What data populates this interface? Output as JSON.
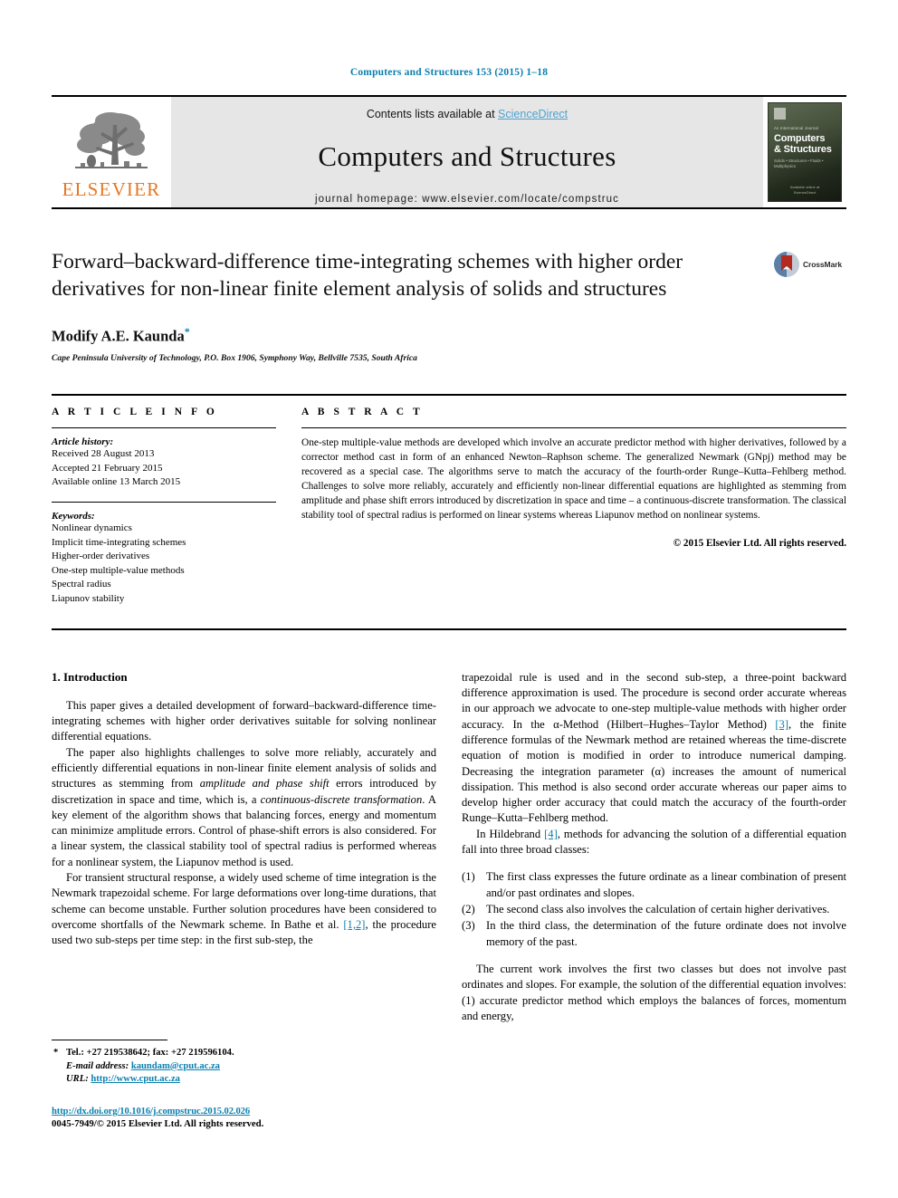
{
  "running_head": "Computers and Structures 153 (2015) 1–18",
  "masthead": {
    "publisher_logo_label": "ELSEVIER",
    "contents_prefix": "Contents lists available at ",
    "contents_link": "ScienceDirect",
    "journal_name": "Computers and Structures",
    "homepage": "journal homepage: www.elsevier.com/locate/compstruc",
    "cover": {
      "kicker": "An International Journal",
      "title_line1": "Computers",
      "title_line2": "& Structures",
      "subtitle": "Solids • Structures • Fluids • Multiphysics",
      "footer_line1": "Available online at",
      "footer_line2": "ScienceDirect"
    }
  },
  "article": {
    "title": "Forward–backward-difference time-integrating schemes with higher order derivatives for non-linear finite element analysis of solids and structures",
    "author": "Modify A.E. Kaunda",
    "author_marker": "*",
    "affiliation": "Cape Peninsula University of Technology, P.O. Box 1906, Symphony Way, Bellville 7535, South Africa",
    "crossmark_label": "CrossMark"
  },
  "article_info": {
    "heading": "A R T I C L E   I N F O",
    "history_label": "Article history:",
    "history": [
      "Received 28 August 2013",
      "Accepted 21 February 2015",
      "Available online 13 March 2015"
    ],
    "keywords_label": "Keywords:",
    "keywords": [
      "Nonlinear dynamics",
      "Implicit time-integrating schemes",
      "Higher-order derivatives",
      "One-step multiple-value methods",
      "Spectral radius",
      "Liapunov stability"
    ]
  },
  "abstract": {
    "heading": "A B S T R A C T",
    "text": "One-step multiple-value methods are developed which involve an accurate predictor method with higher derivatives, followed by a corrector method cast in form of an enhanced Newton–Raphson scheme. The generalized Newmark (GNpj) method may be recovered as a special case. The algorithms serve to match the accuracy of the fourth-order Runge–Kutta–Fehlberg method. Challenges to solve more reliably, accurately and efficiently non-linear differential equations are highlighted as stemming from amplitude and phase shift errors introduced by discretization in space and time – a continuous-discrete transformation. The classical stability tool of spectral radius is performed on linear systems whereas Liapunov method on nonlinear systems.",
    "copyright": "© 2015 Elsevier Ltd. All rights reserved."
  },
  "body": {
    "section_number_title": "1. Introduction",
    "left_paragraphs": [
      "This paper gives a detailed development of forward–backward-difference time-integrating schemes with higher order derivatives suitable for solving nonlinear differential equations.",
      "The paper also highlights challenges to solve more reliably, accurately and efficiently differential equations in non-linear finite element analysis of solids and structures as stemming from amplitude and phase shift errors introduced by discretization in space and time, which is, a continuous-discrete transformation. A key element of the algorithm shows that balancing forces, energy and momentum can minimize amplitude errors. Control of phase-shift errors is also considered. For a linear system, the classical stability tool of spectral radius is performed whereas for a nonlinear system, the Liapunov method is used.",
      "For transient structural response, a widely used scheme of time integration is the Newmark trapezoidal scheme. For large deformations over long-time durations, that scheme can become unstable. Further solution procedures have been considered to overcome shortfalls of the Newmark scheme. In Bathe et al. [1,2], the procedure used two sub-steps per time step: in the first sub-step, the"
    ],
    "right_paragraphs_before_list": [
      "trapezoidal rule is used and in the second sub-step, a three-point backward difference approximation is used. The procedure is second order accurate whereas in our approach we advocate to one-step multiple-value methods with higher order accuracy. In the α-Method (Hilbert–Hughes–Taylor Method) [3], the finite difference formulas of the Newmark method are retained whereas the time-discrete equation of motion is modified in order to introduce numerical damping. Decreasing the integration parameter (α) increases the amount of numerical dissipation. This method is also second order accurate whereas our paper aims to develop higher order accuracy that could match the accuracy of the fourth-order Runge–Kutta–Fehlberg method.",
      "In Hildebrand [4], methods for advancing the solution of a differential equation fall into three broad classes:"
    ],
    "classes_list": [
      {
        "num": "(1)",
        "text": "The first class expresses the future ordinate as a linear combination of present and/or past ordinates and slopes."
      },
      {
        "num": "(2)",
        "text": "The second class also involves the calculation of certain higher derivatives."
      },
      {
        "num": "(3)",
        "text": "In the third class, the determination of the future ordinate does not involve memory of the past."
      }
    ],
    "right_paragraphs_after_list": [
      "The current work involves the first two classes but does not involve past ordinates and slopes. For example, the solution of the differential equation involves: (1) accurate predictor method which employs the balances of forces, momentum and energy,"
    ],
    "italic_spans": [
      "amplitude and phase shift",
      "continuous-discrete transformation"
    ],
    "reference_links": [
      "[1,2]",
      "[3]",
      "[4]"
    ]
  },
  "footnotes": {
    "star": "*",
    "tel_line": "Tel.: +27 219538642; fax: +27 219596104.",
    "email_label": "E-mail address:",
    "email": "kaundam@cput.ac.za",
    "url_label": "URL:",
    "url": "http://www.cput.ac.za"
  },
  "footer": {
    "doi": "http://dx.doi.org/10.1016/j.compstruc.2015.02.026",
    "issn_copyright": "0045-7949/© 2015 Elsevier Ltd. All rights reserved."
  },
  "colors": {
    "link_blue": "#0b7faf",
    "sciencedirect_blue": "#4ea3d1",
    "elsevier_orange": "#e87722",
    "masthead_grey": "#e6e6e6"
  }
}
